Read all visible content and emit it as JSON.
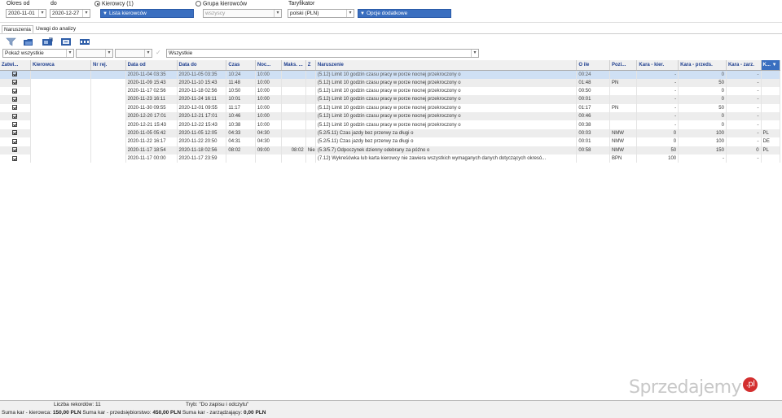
{
  "header": {
    "okres_od_label": "Okres od",
    "okres_od_value": "2020-11-01",
    "do_label": "do",
    "do_value": "2020-12-27",
    "kierowcy_radio_label": "Kierowcy (1)",
    "lista_kierowcow_label": "Lista kierowców",
    "grupa_radio_label": "Grupa kierowców",
    "grupa_value": "wszyscy",
    "taryfikator_label": "Taryfikator",
    "taryfikator_value": "polski (PLN)",
    "opcje_label": "Opcje dodatkowe"
  },
  "tabs": [
    {
      "label": "Naruszenia",
      "active": true
    },
    {
      "label": "Uwagi do analizy",
      "active": false
    }
  ],
  "toolbar_icons": [
    "filter-icon",
    "folder-open-icon",
    "export-icon",
    "print-icon",
    "columns-icon"
  ],
  "filters": {
    "show_value": "Pokaż wszystkie",
    "naruszenie_value": "Wszystkie"
  },
  "columns": [
    "Zatwi...",
    "Kierowca",
    "Nr rej.",
    "Data od",
    "Data do",
    "Czas",
    "Noc...",
    "Maks. ...",
    "Z",
    "Naruszenie",
    "O ile",
    "Pozi...",
    "Kara - kier.",
    "Kara - przeds.",
    "Kara - zarz.",
    "K..."
  ],
  "rows": [
    {
      "data_od": "2020-11-04 03:35",
      "data_do": "2020-11-05 03:35",
      "czas": "10:24",
      "noc": "10:00",
      "maks": "",
      "z": "",
      "naruszenie": "(5.12) Limit 10 godzin czasu pracy w porze nocnej przekroczony o",
      "o_ile": "00:24",
      "poziom": "",
      "kara_kier": "-",
      "kara_przeds": "0",
      "kara_zarz": "-",
      "k": ""
    },
    {
      "data_od": "2020-11-09 15:43",
      "data_do": "2020-11-10 15:43",
      "czas": "11:48",
      "noc": "10:00",
      "maks": "",
      "z": "",
      "naruszenie": "(5.12) Limit 10 godzin czasu pracy w porze nocnej przekroczony o",
      "o_ile": "01:48",
      "poziom": "PN",
      "kara_kier": "-",
      "kara_przeds": "50",
      "kara_zarz": "-",
      "k": ""
    },
    {
      "data_od": "2020-11-17 02:56",
      "data_do": "2020-11-18 02:56",
      "czas": "10:50",
      "noc": "10:00",
      "maks": "",
      "z": "",
      "naruszenie": "(5.12) Limit 10 godzin czasu pracy w porze nocnej przekroczony o",
      "o_ile": "00:50",
      "poziom": "",
      "kara_kier": "-",
      "kara_przeds": "0",
      "kara_zarz": "-",
      "k": ""
    },
    {
      "data_od": "2020-11-23 16:11",
      "data_do": "2020-11-24 16:11",
      "czas": "10:01",
      "noc": "10:00",
      "maks": "",
      "z": "",
      "naruszenie": "(5.12) Limit 10 godzin czasu pracy w porze nocnej przekroczony o",
      "o_ile": "00:01",
      "poziom": "",
      "kara_kier": "-",
      "kara_przeds": "0",
      "kara_zarz": "-",
      "k": ""
    },
    {
      "data_od": "2020-11-30 09:55",
      "data_do": "2020-12-01 09:55",
      "czas": "11:17",
      "noc": "10:00",
      "maks": "",
      "z": "",
      "naruszenie": "(5.12) Limit 10 godzin czasu pracy w porze nocnej przekroczony o",
      "o_ile": "01:17",
      "poziom": "PN",
      "kara_kier": "-",
      "kara_przeds": "50",
      "kara_zarz": "-",
      "k": ""
    },
    {
      "data_od": "2020-12-20 17:01",
      "data_do": "2020-12-21 17:01",
      "czas": "10:46",
      "noc": "10:00",
      "maks": "",
      "z": "",
      "naruszenie": "(5.12) Limit 10 godzin czasu pracy w porze nocnej przekroczony o",
      "o_ile": "00:46",
      "poziom": "",
      "kara_kier": "-",
      "kara_przeds": "0",
      "kara_zarz": "-",
      "k": ""
    },
    {
      "data_od": "2020-12-21 15:43",
      "data_do": "2020-12-22 15:43",
      "czas": "10:38",
      "noc": "10:00",
      "maks": "",
      "z": "",
      "naruszenie": "(5.12) Limit 10 godzin czasu pracy w porze nocnej przekroczony o",
      "o_ile": "00:38",
      "poziom": "",
      "kara_kier": "-",
      "kara_przeds": "0",
      "kara_zarz": "-",
      "k": ""
    },
    {
      "data_od": "2020-11-05 05:42",
      "data_do": "2020-11-05 12:05",
      "czas": "04:33",
      "noc": "04:30",
      "maks": "",
      "z": "",
      "naruszenie": "(5.2/5.11) Czas jazdy bez przerwy za długi o",
      "o_ile": "00:03",
      "poziom": "NMW",
      "kara_kier": "0",
      "kara_przeds": "100",
      "kara_zarz": "-",
      "k": "PL"
    },
    {
      "data_od": "2020-11-22 16:17",
      "data_do": "2020-11-22 20:50",
      "czas": "04:31",
      "noc": "04:30",
      "maks": "",
      "z": "",
      "naruszenie": "(5.2/5.11) Czas jazdy bez przerwy za długi o",
      "o_ile": "00:01",
      "poziom": "NMW",
      "kara_kier": "0",
      "kara_przeds": "100",
      "kara_zarz": "-",
      "k": "DE"
    },
    {
      "data_od": "2020-11-17 18:54",
      "data_do": "2020-11-18 02:56",
      "czas": "08:02",
      "noc": "09:00",
      "maks": "08:02",
      "z": "Nie",
      "naruszenie": "(5.3/5.7) Odpoczynek dzienny odebrany za późno o",
      "o_ile": "00:58",
      "poziom": "NMW",
      "kara_kier": "50",
      "kara_przeds": "150",
      "kara_zarz": "0",
      "k": "PL"
    },
    {
      "data_od": "2020-11-17 00:00",
      "data_do": "2020-11-17 23:59",
      "czas": "",
      "noc": "",
      "maks": "",
      "z": "",
      "naruszenie": "(7.12) Wykreśówka lub karta kierowcy nie zawiera wszystkich wymaganych danych dotyczących okresó...",
      "o_ile": "",
      "poziom": "BPN",
      "kara_kier": "100",
      "kara_przeds": "-",
      "kara_zarz": "-",
      "k": ""
    }
  ],
  "status": {
    "record_count": "Liczba rekordów: 11",
    "mode": "Tryb: \"Do zapisu i odczytu\"",
    "suma_kier_label": "Suma kar - kierowca:",
    "suma_kier_value": "150,00 PLN",
    "suma_przeds_label": "Suma kar - przedsiębiorstwo:",
    "suma_przeds_value": "450,00 PLN",
    "suma_zarz_label": "Suma kar - zarządzający:",
    "suma_zarz_value": "0,00 PLN"
  },
  "watermark": "Sprzedajemy",
  "watermark_badge": ".pl",
  "colors": {
    "accent": "#3a6fc0",
    "selected_row": "#cfe0f4"
  }
}
